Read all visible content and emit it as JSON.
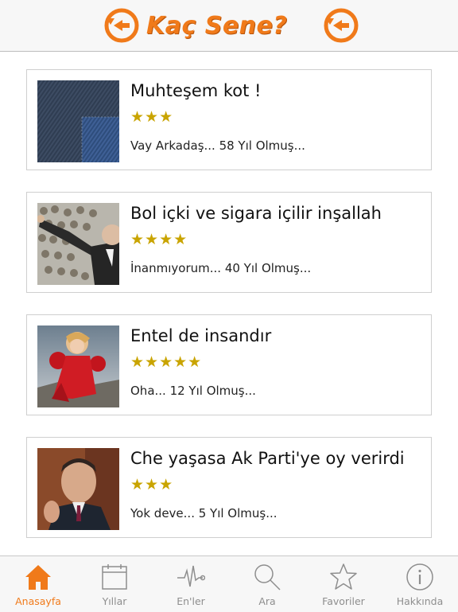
{
  "header": {
    "title": "Kaç Sene?",
    "colors": {
      "accent": "#f07a1a",
      "background": "#f7f7f7"
    }
  },
  "items": [
    {
      "title": "Muhteşem kot !",
      "rating": 3,
      "stars": "★★★",
      "subtitle": "Vay Arkadaş... 58 Yıl Olmuş..."
    },
    {
      "title": "Bol içki ve sigara içilir inşallah",
      "rating": 4,
      "stars": "★★★★",
      "subtitle": "İnanmıyorum... 40 Yıl Olmuş..."
    },
    {
      "title": "Entel de insandır",
      "rating": 5,
      "stars": "★★★★★",
      "subtitle": "Oha... 12 Yıl Olmuş..."
    },
    {
      "title": "Che yaşasa Ak Parti'ye oy verirdi",
      "rating": 3,
      "stars": "★★★",
      "subtitle": "Yok deve... 5 Yıl Olmuş..."
    }
  ],
  "tabbar": {
    "active": "Anasayfa",
    "tabs": [
      {
        "label": "Anasayfa",
        "icon": "home-icon"
      },
      {
        "label": "Yıllar",
        "icon": "calendar-icon"
      },
      {
        "label": "En'ler",
        "icon": "pulse-icon"
      },
      {
        "label": "Ara",
        "icon": "search-icon"
      },
      {
        "label": "Favoriler",
        "icon": "star-icon"
      },
      {
        "label": "Hakkında",
        "icon": "info-icon"
      }
    ]
  }
}
